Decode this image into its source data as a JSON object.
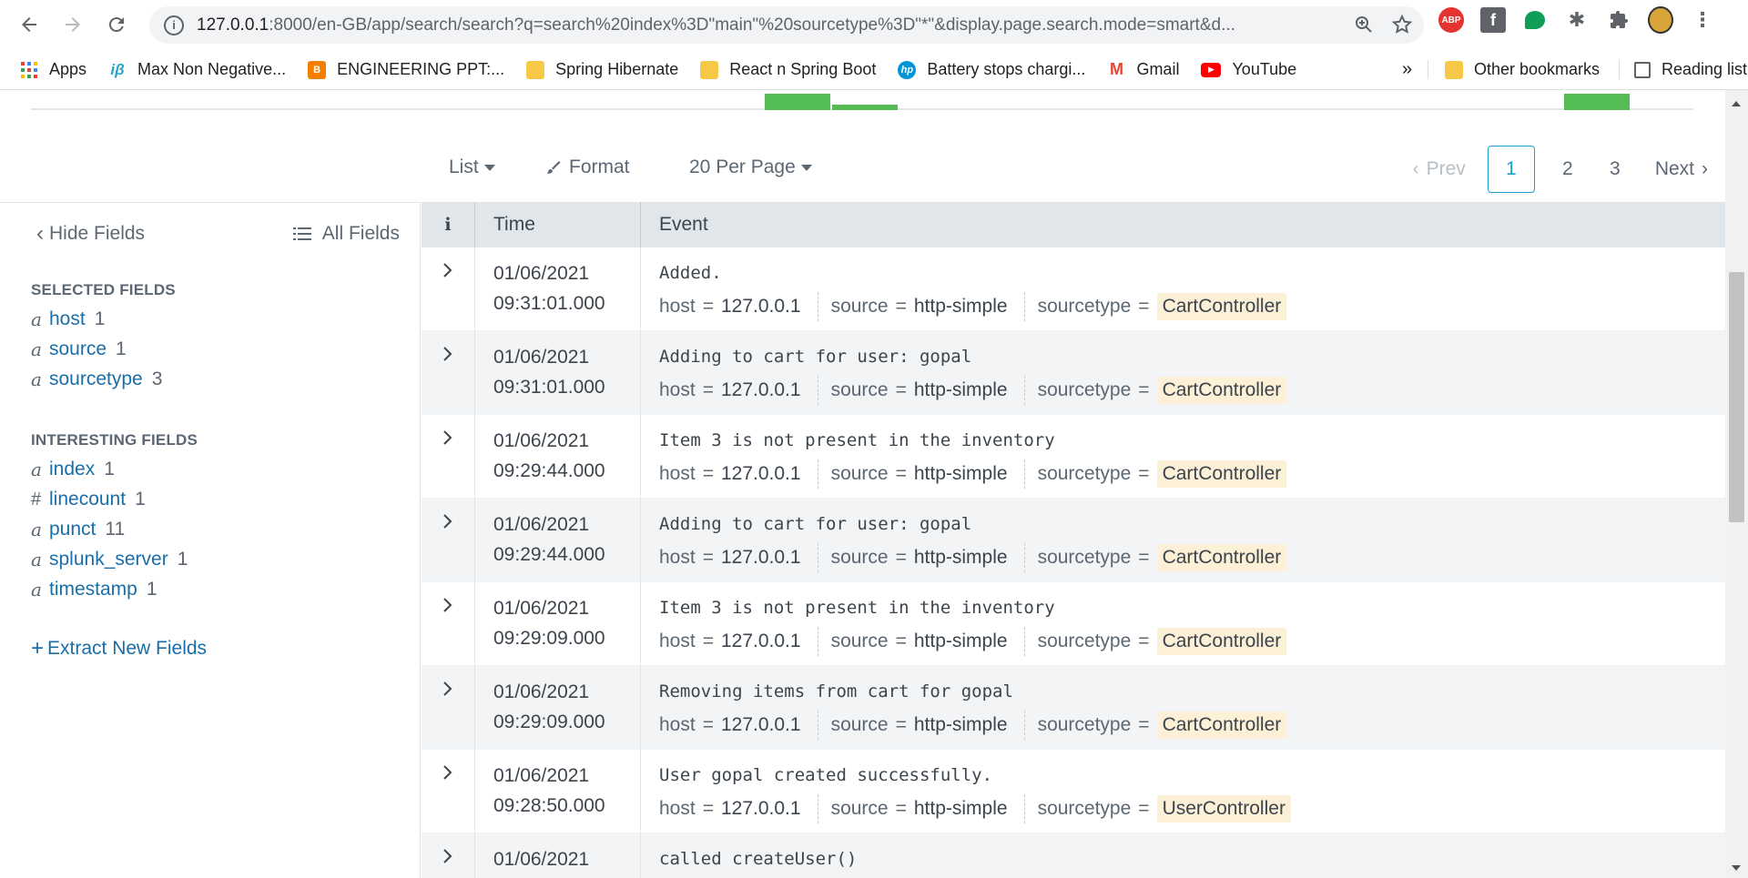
{
  "browser": {
    "url_host": "127.0.0.1",
    "url_path": ":8000/en-GB/app/search/search?q=search%20index%3D\"main\"%20sourcetype%3D\"*\"&display.page.search.mode=smart&d...",
    "bookmarks": [
      {
        "label": "Apps",
        "icon": "apps-grid-icon"
      },
      {
        "label": "Max Non Negative...",
        "icon": "ib-icon"
      },
      {
        "label": "ENGINEERING PPT:...",
        "icon": "blogger-icon"
      },
      {
        "label": "Spring Hibernate",
        "icon": "folder-icon"
      },
      {
        "label": "React n Spring Boot",
        "icon": "folder-icon"
      },
      {
        "label": "Battery stops chargi...",
        "icon": "hp-icon"
      },
      {
        "label": "Gmail",
        "icon": "gmail-icon"
      },
      {
        "label": "YouTube",
        "icon": "youtube-icon"
      }
    ],
    "overflow_label": "»",
    "other_bookmarks": "Other bookmarks",
    "reading_list": "Reading list",
    "extensions": [
      {
        "label": "ABP",
        "color": "#e3342f"
      },
      {
        "label": "f",
        "color": "#5f6368"
      }
    ]
  },
  "toolbar": {
    "list_label": "List",
    "format_label": "Format",
    "per_page_label": "20 Per Page",
    "prev_label": "Prev",
    "next_label": "Next",
    "pages": [
      "1",
      "2",
      "3"
    ]
  },
  "sidebar": {
    "hide_fields": "Hide Fields",
    "all_fields": "All Fields",
    "selected_heading": "SELECTED FIELDS",
    "selected_fields": [
      {
        "type": "a",
        "name": "host",
        "count": "1"
      },
      {
        "type": "a",
        "name": "source",
        "count": "1"
      },
      {
        "type": "a",
        "name": "sourcetype",
        "count": "3"
      }
    ],
    "interesting_heading": "INTERESTING FIELDS",
    "interesting_fields": [
      {
        "type": "a",
        "name": "index",
        "count": "1"
      },
      {
        "type": "#",
        "name": "linecount",
        "count": "1"
      },
      {
        "type": "a",
        "name": "punct",
        "count": "11"
      },
      {
        "type": "a",
        "name": "splunk_server",
        "count": "1"
      },
      {
        "type": "a",
        "name": "timestamp",
        "count": "1"
      }
    ],
    "extract_label": "Extract New Fields"
  },
  "table": {
    "col_info": "i",
    "col_time": "Time",
    "col_event": "Event",
    "kv_labels": {
      "host": "host",
      "source": "source",
      "sourcetype": "sourcetype",
      "eq": "="
    },
    "rows": [
      {
        "date": "01/06/2021",
        "time": "09:31:01.000",
        "raw": "Added.",
        "host": "127.0.0.1",
        "source": "http-simple",
        "sourcetype": "CartController"
      },
      {
        "date": "01/06/2021",
        "time": "09:31:01.000",
        "raw": "Adding to cart for user: gopal",
        "host": "127.0.0.1",
        "source": "http-simple",
        "sourcetype": "CartController"
      },
      {
        "date": "01/06/2021",
        "time": "09:29:44.000",
        "raw": "Item 3 is not present in the inventory",
        "host": "127.0.0.1",
        "source": "http-simple",
        "sourcetype": "CartController"
      },
      {
        "date": "01/06/2021",
        "time": "09:29:44.000",
        "raw": "Adding to cart for user: gopal",
        "host": "127.0.0.1",
        "source": "http-simple",
        "sourcetype": "CartController"
      },
      {
        "date": "01/06/2021",
        "time": "09:29:09.000",
        "raw": "Item 3 is not present in the inventory",
        "host": "127.0.0.1",
        "source": "http-simple",
        "sourcetype": "CartController"
      },
      {
        "date": "01/06/2021",
        "time": "09:29:09.000",
        "raw": "Removing items from cart for gopal",
        "host": "127.0.0.1",
        "source": "http-simple",
        "sourcetype": "CartController"
      },
      {
        "date": "01/06/2021",
        "time": "09:28:50.000",
        "raw": "User gopal created successfully.",
        "host": "127.0.0.1",
        "source": "http-simple",
        "sourcetype": "UserController"
      },
      {
        "date": "01/06/2021",
        "time": "",
        "raw": "called createUser()",
        "host": "",
        "source": "",
        "sourcetype": ""
      }
    ]
  },
  "colors": {
    "link": "#1a6ea8",
    "accent": "#1a9ccf",
    "timeline_bar": "#53bd53",
    "highlight": "#fcf0d6"
  }
}
